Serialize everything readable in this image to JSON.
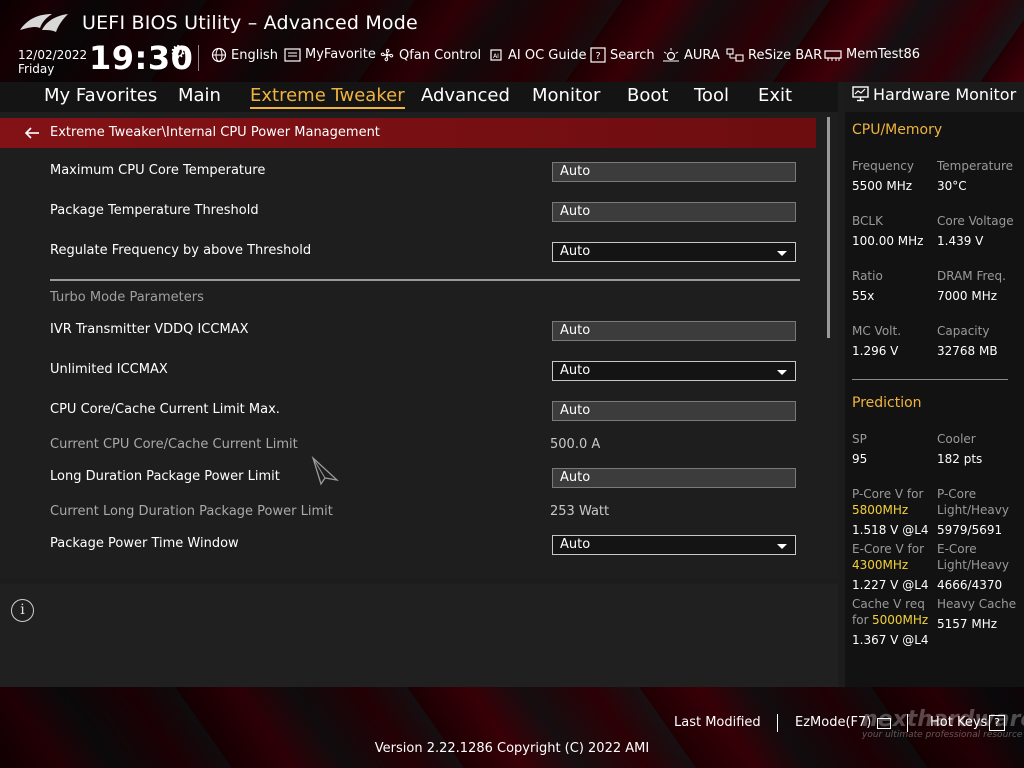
{
  "app": {
    "title": "UEFI BIOS Utility – Advanced Mode"
  },
  "clock": {
    "date": "12/02/2022",
    "day": "Friday",
    "time": "19:30"
  },
  "toolbar": [
    {
      "label": "English",
      "icon": "globe-icon"
    },
    {
      "label": "MyFavorite",
      "icon": "favorite-icon"
    },
    {
      "label": "Qfan Control",
      "icon": "fan-icon"
    },
    {
      "label": "AI OC Guide",
      "icon": "ai-icon"
    },
    {
      "label": "Search",
      "icon": "search-icon"
    },
    {
      "label": "AURA",
      "icon": "aura-icon"
    },
    {
      "label": "ReSize BAR",
      "icon": "resize-bar-icon"
    },
    {
      "label": "MemTest86",
      "icon": "memtest-icon"
    }
  ],
  "menu": {
    "items": [
      "My Favorites",
      "Main",
      "Extreme Tweaker",
      "Advanced",
      "Monitor",
      "Boot",
      "Tool",
      "Exit"
    ],
    "active": "Extreme Tweaker"
  },
  "breadcrumb": "Extreme Tweaker\\Internal CPU Power Management",
  "settings": {
    "max_cpu_temp": {
      "label": "Maximum CPU Core Temperature",
      "value": "Auto"
    },
    "pkg_temp_threshold": {
      "label": "Package Temperature Threshold",
      "value": "Auto"
    },
    "regulate_freq": {
      "label": "Regulate Frequency by above Threshold",
      "value": "Auto"
    },
    "turbo_section": "Turbo Mode Parameters",
    "ivr_vddq": {
      "label": "IVR Transmitter VDDQ ICCMAX",
      "value": "Auto"
    },
    "unlimited_iccmax": {
      "label": "Unlimited ICCMAX",
      "value": "Auto"
    },
    "core_cache_limit": {
      "label": "CPU Core/Cache Current Limit Max.",
      "value": "Auto"
    },
    "current_core_cache": {
      "label": "Current CPU Core/Cache Current Limit",
      "value": "500.0 A"
    },
    "long_dur_ppl": {
      "label": "Long Duration Package Power Limit",
      "value": "Auto"
    },
    "current_long_dur": {
      "label": "Current Long Duration Package Power Limit",
      "value": "253 Watt"
    },
    "pkg_time_window": {
      "label": "Package Power Time Window",
      "value": "Auto"
    }
  },
  "hardware_monitor": {
    "title": "Hardware Monitor",
    "cpu_memory": {
      "title": "CPU/Memory",
      "frequency": {
        "label": "Frequency",
        "value": "5500 MHz"
      },
      "temperature": {
        "label": "Temperature",
        "value": "30°C"
      },
      "bclk": {
        "label": "BCLK",
        "value": "100.00 MHz"
      },
      "core_voltage": {
        "label": "Core Voltage",
        "value": "1.439 V"
      },
      "ratio": {
        "label": "Ratio",
        "value": "55x"
      },
      "dram_freq": {
        "label": "DRAM Freq.",
        "value": "7000 MHz"
      },
      "mc_volt": {
        "label": "MC Volt.",
        "value": "1.296 V"
      },
      "capacity": {
        "label": "Capacity",
        "value": "32768 MB"
      }
    },
    "prediction": {
      "title": "Prediction",
      "sp": {
        "label": "SP",
        "value": "95"
      },
      "cooler": {
        "label": "Cooler",
        "value": "182 pts"
      },
      "pcore_v": {
        "label": "P-Core V for",
        "freq": "5800MHz",
        "value": "1.518 V @L4"
      },
      "pcore_lh": {
        "label1": "P-Core",
        "label2": "Light/Heavy",
        "value": "5979/5691"
      },
      "ecore_v": {
        "label": "E-Core V for",
        "freq": "4300MHz",
        "value": "1.227 V @L4"
      },
      "ecore_lh": {
        "label1": "E-Core",
        "label2": "Light/Heavy",
        "value": "4666/4370"
      },
      "cache_v": {
        "label1": "Cache V req",
        "label2": "for",
        "freq": "5000MHz",
        "value": "1.367 V @L4"
      },
      "heavy_cache": {
        "label": "Heavy Cache",
        "value": "5157 MHz"
      }
    }
  },
  "footer": {
    "last_modified": "Last Modified",
    "ezmode": "EzMode(F7)",
    "hotkeys": "Hot Keys",
    "hotkey_symbol": "?",
    "version": "Version 2.22.1286 Copyright (C) 2022 AMI"
  },
  "watermark": {
    "brand": "nexthardware",
    "tagline": "your ultimate professional resource"
  }
}
